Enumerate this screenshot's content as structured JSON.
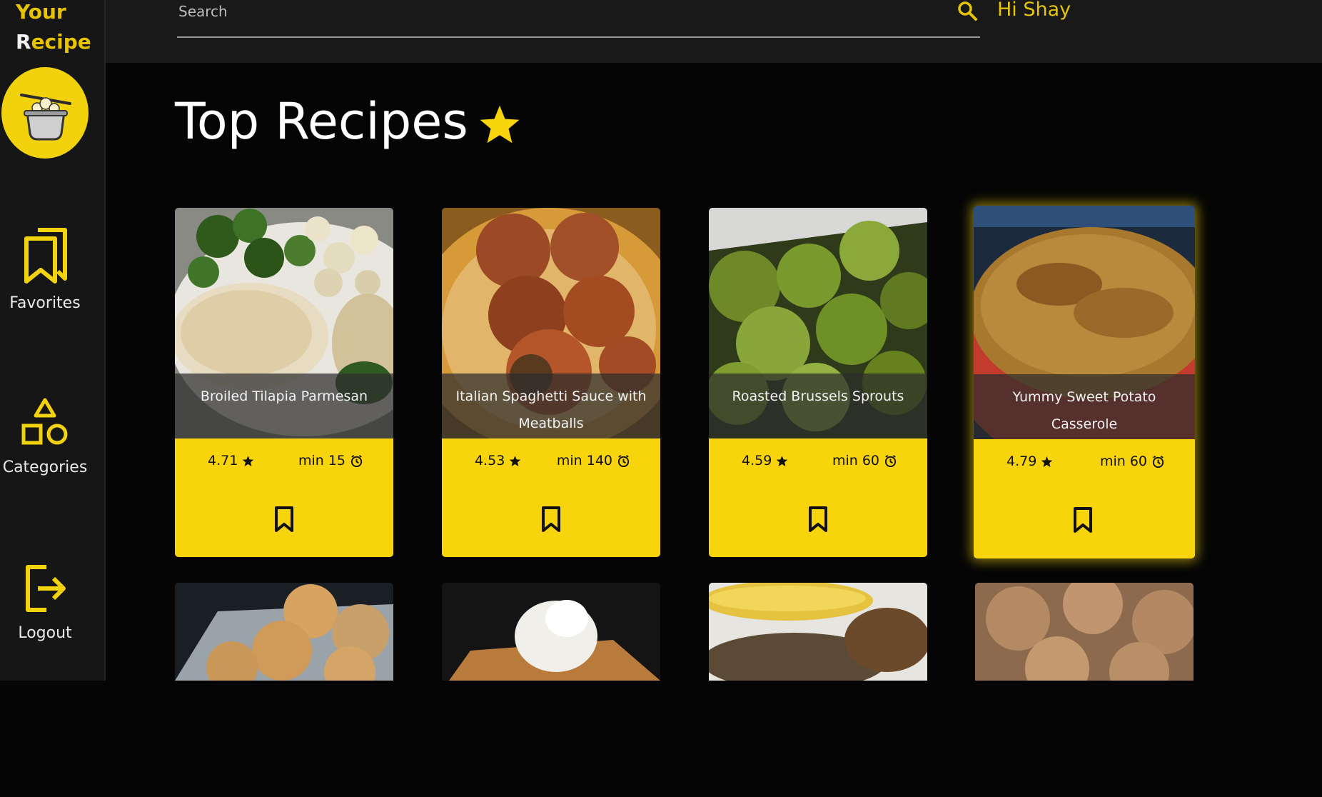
{
  "brand": {
    "line1": "Your",
    "line2_first": "R",
    "line2_rest": "ecipe"
  },
  "sidebar": {
    "items": [
      {
        "label": "Favorites",
        "icon": "bookmarks-icon"
      },
      {
        "label": "Categories",
        "icon": "shapes-icon"
      },
      {
        "label": "Logout",
        "icon": "logout-icon"
      }
    ]
  },
  "header": {
    "search_placeholder": "Search",
    "greeting": "Hi Shay"
  },
  "page": {
    "title": "Top Recipes"
  },
  "recipes": [
    {
      "name": "Broiled Tilapia Parmesan",
      "rating": "4.71",
      "time": "min 15"
    },
    {
      "name": "Italian Spaghetti Sauce with Meatballs",
      "rating": "4.53",
      "time": "min 140"
    },
    {
      "name": "Roasted Brussels Sprouts",
      "rating": "4.59",
      "time": "min 60"
    },
    {
      "name": "Yummy Sweet Potato Casserole",
      "rating": "4.79",
      "time": "min 60"
    }
  ],
  "colors": {
    "accent": "#f7d40b",
    "background": "#050505",
    "sidebar": "#161616"
  }
}
